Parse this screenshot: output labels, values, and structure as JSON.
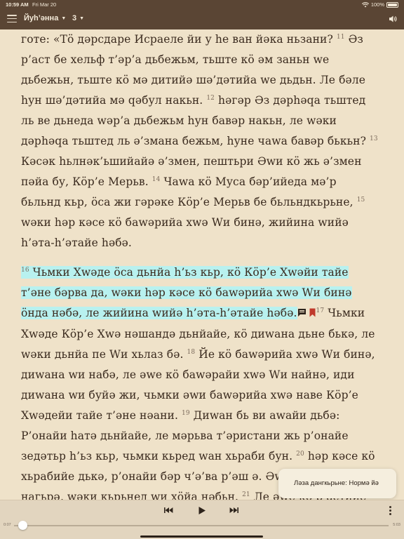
{
  "status_bar": {
    "time": "10:59 AM",
    "date": "Fri Mar 20",
    "battery": "100%"
  },
  "nav": {
    "book": "Йуһ’әнна",
    "chapter": "3"
  },
  "text": {
    "pre": [
      {
        "t": "готе: «Тӧ дәрсдаре Исраеле йи у һе ван йәка ньзани? "
      },
      {
        "v": "11"
      },
      {
        "t": " Әз р’аст бе хельф т’әр’а дьбежьм, тьште кӧ әм заньн ԝе дьбежьн, тьште кӧ мә дитийә шә’дәтийа ԝе дьдьн. Ле бәле һун шә’дәтийа мә qәбул накьн. "
      },
      {
        "v": "12"
      },
      {
        "t": " һәгәр Әз дәрһәqа тьштед ль ве дьнеда ԝәр’а дьбежьм һун бавәр накьн, ле ԝәки дәрһәqа тьштед ль ә’змана бежьм, һуне чаԝа бавәр бькьн? "
      },
      {
        "v": "13"
      },
      {
        "t": " Кәсәк һьлнәк’ьшийайә ә’змен, пештьри Әԝи кӧ жь ә’змен пәйа бу, Кӧр’е Мерьв. "
      },
      {
        "v": "14"
      },
      {
        "t": " Чаԝа кӧ Муса бәр’ийеда мә’р бьльнд кьр, ӧса жи гәрәке Кӧр’е Мерьв бе бьльндкьрьне, "
      },
      {
        "v": "15"
      },
      {
        "t": " ԝәки һәр кәсе кӧ баԝәрийа хԝә Wи бинә, жийина ԝийә һ’әта-һ’әтайе һәбә."
      }
    ],
    "hl": [
      {
        "v": "16"
      },
      {
        "t": " Чьмки Хԝәде ӧса дьнйа һ’ьз кьр, кӧ Кӧр’е Хԝәйи тайе т’әне бәрва да, ԝәки һәр кәсе кӧ баԝәрийа хԝә Wи бинә ӧнда нәбә, ле жийина ԝийә һ’әта-һ’әтайе һәбә."
      }
    ],
    "post": [
      {
        "v": "17"
      },
      {
        "t": " Чьмки Хԝәде Кӧр’е Хԝә нәшандә дьнйайе, кӧ диԝана дьне бькә, ле ԝәки дьнйа пе Wи хьлаз бә. "
      },
      {
        "v": "18"
      },
      {
        "t": " Йе кӧ баԝәрийа хԝә Wи бинә, диԝана ԝи набә, ле әԝе кӧ баԝәрайи хԝә Wи найнә, иди диԝана ԝи буйә жи, чьмки әԝи баԝәрийа хԝә наве Кӧр’е Хԝәдейи тайе т’әне нәани. "
      },
      {
        "v": "19"
      },
      {
        "t": " Диԝан бь ви аԝайи дьбә: Р’онайи һатә дьнйайе, ле мәрьва т’әристани жь р’онайе зедәтьр һ’ьз кьр, чьмки кьред ԝан хьраби бун. "
      },
      {
        "v": "20"
      },
      {
        "t": " һәр кәсе кӧ хьрабийе дькә, р’онайи бәр ч’ә’ва р’әш ә. Әԝ хԝә ль р’онайе нагьрә, ԝәки кьрьнед ԝи хӧйа нәбьн. "
      },
      {
        "v": "21"
      },
      {
        "t": " Ле әԝе кӧ р’астийе дькә, әԝ хԝә ль р’онайе дьгьрә, ԝәки әԝ йан бә"
      }
    ]
  },
  "toast": {
    "message": "Ләза дангкьрьне: Нормә йә"
  },
  "player": {
    "elapsed": "0:07",
    "total": "5:03",
    "progress": 0.023
  },
  "icons": {
    "menu": "hamburger-icon",
    "speaker": "speaker-icon",
    "prev": "skip-back-icon",
    "play": "play-icon",
    "next": "skip-forward-icon",
    "more": "more-vertical-icon",
    "note": "note-icon",
    "bookmark": "bookmark-icon"
  },
  "colors": {
    "bar": "#5a4534",
    "page": "#efe2c9",
    "highlight": "#b8f1ef",
    "bookmark": "#c0392b"
  }
}
